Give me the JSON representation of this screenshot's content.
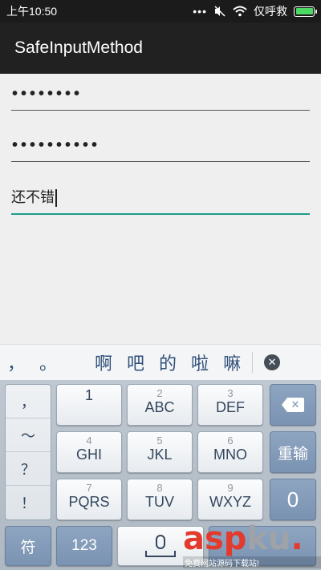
{
  "status_bar": {
    "time": "上午10:50",
    "dots": "•••",
    "carrier": "仅呼救"
  },
  "app_bar": {
    "title": "SafeInputMethod"
  },
  "fields": [
    {
      "value": "••••••••"
    },
    {
      "value": "••••••••••"
    },
    {
      "value": "还不错"
    }
  ],
  "candidates": {
    "punct": [
      "，",
      "。"
    ],
    "chars": [
      "啊",
      "吧",
      "的",
      "啦",
      "嘛"
    ]
  },
  "keyboard": {
    "punct_column": [
      "，",
      "～",
      "？",
      "！"
    ],
    "keys": [
      {
        "sub": "",
        "main": "1"
      },
      {
        "sub": "2",
        "main": "ABC"
      },
      {
        "sub": "3",
        "main": "DEF"
      },
      {
        "sub": "4",
        "main": "GHI"
      },
      {
        "sub": "5",
        "main": "JKL"
      },
      {
        "sub": "6",
        "main": "MNO"
      },
      {
        "sub": "7",
        "main": "PQRS"
      },
      {
        "sub": "8",
        "main": "TUV"
      },
      {
        "sub": "9",
        "main": "WXYZ"
      }
    ],
    "reenter": "重输",
    "zero": "0",
    "symbol": "符",
    "num123": "123"
  },
  "watermark": {
    "text_red": "asp",
    "text_gray": "ku",
    "suffix": ".",
    "sub": "免费网站源码下载站!"
  },
  "colors": {
    "accent": "#1e9c8c",
    "key_dark": "#7a93b2",
    "battery": "#4cd964"
  }
}
